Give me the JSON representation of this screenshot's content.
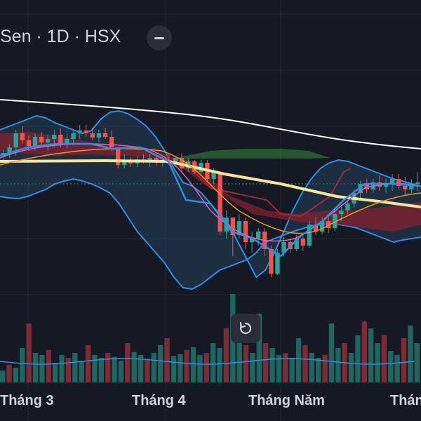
{
  "header": {
    "title": "Sen · 1D · HSX"
  },
  "chart_data": {
    "type": "candlestick",
    "title": "Sen · 1D · HSX",
    "x_tick_labels": [
      "Tháng 3",
      "Tháng 4",
      "Tháng Năm",
      "Thán"
    ],
    "candles": [
      {
        "o": 222,
        "h": 213,
        "l": 230,
        "c": 218
      },
      {
        "o": 218,
        "h": 205,
        "l": 225,
        "c": 210
      },
      {
        "o": 210,
        "h": 185,
        "l": 222,
        "c": 190
      },
      {
        "o": 190,
        "h": 180,
        "l": 205,
        "c": 200
      },
      {
        "o": 200,
        "h": 193,
        "l": 215,
        "c": 208
      },
      {
        "o": 208,
        "h": 190,
        "l": 215,
        "c": 195
      },
      {
        "o": 195,
        "h": 188,
        "l": 208,
        "c": 203
      },
      {
        "o": 203,
        "h": 192,
        "l": 215,
        "c": 198
      },
      {
        "o": 198,
        "h": 185,
        "l": 210,
        "c": 192
      },
      {
        "o": 192,
        "h": 183,
        "l": 210,
        "c": 205
      },
      {
        "o": 205,
        "h": 190,
        "l": 212,
        "c": 198
      },
      {
        "o": 198,
        "h": 187,
        "l": 205,
        "c": 190
      },
      {
        "o": 190,
        "h": 178,
        "l": 198,
        "c": 186
      },
      {
        "o": 186,
        "h": 178,
        "l": 195,
        "c": 190
      },
      {
        "o": 190,
        "h": 182,
        "l": 200,
        "c": 196
      },
      {
        "o": 196,
        "h": 185,
        "l": 203,
        "c": 190
      },
      {
        "o": 190,
        "h": 182,
        "l": 198,
        "c": 195
      },
      {
        "o": 195,
        "h": 186,
        "l": 215,
        "c": 210
      },
      {
        "o": 210,
        "h": 215,
        "l": 240,
        "c": 235
      },
      {
        "o": 235,
        "h": 220,
        "l": 240,
        "c": 228
      },
      {
        "o": 228,
        "h": 224,
        "l": 238,
        "c": 233
      },
      {
        "o": 233,
        "h": 222,
        "l": 238,
        "c": 227
      },
      {
        "o": 227,
        "h": 220,
        "l": 233,
        "c": 231
      },
      {
        "o": 231,
        "h": 220,
        "l": 238,
        "c": 225
      },
      {
        "o": 225,
        "h": 220,
        "l": 236,
        "c": 232
      },
      {
        "o": 232,
        "h": 222,
        "l": 238,
        "c": 228
      },
      {
        "o": 228,
        "h": 220,
        "l": 236,
        "c": 233
      },
      {
        "o": 233,
        "h": 222,
        "l": 238,
        "c": 225
      },
      {
        "o": 225,
        "h": 218,
        "l": 245,
        "c": 240
      },
      {
        "o": 240,
        "h": 225,
        "l": 245,
        "c": 230
      },
      {
        "o": 230,
        "h": 228,
        "l": 248,
        "c": 245
      },
      {
        "o": 245,
        "h": 228,
        "l": 248,
        "c": 232
      },
      {
        "o": 232,
        "h": 228,
        "l": 260,
        "c": 255
      },
      {
        "o": 255,
        "h": 240,
        "l": 262,
        "c": 245
      },
      {
        "o": 245,
        "h": 260,
        "l": 335,
        "c": 330
      },
      {
        "o": 330,
        "h": 300,
        "l": 340,
        "c": 310
      },
      {
        "o": 310,
        "h": 320,
        "l": 365,
        "c": 335
      },
      {
        "o": 335,
        "h": 305,
        "l": 340,
        "c": 315
      },
      {
        "o": 315,
        "h": 310,
        "l": 355,
        "c": 345
      },
      {
        "o": 345,
        "h": 330,
        "l": 360,
        "c": 340
      },
      {
        "o": 340,
        "h": 325,
        "l": 350,
        "c": 330
      },
      {
        "o": 330,
        "h": 325,
        "l": 365,
        "c": 355
      },
      {
        "o": 355,
        "h": 350,
        "l": 395,
        "c": 390
      },
      {
        "o": 390,
        "h": 355,
        "l": 392,
        "c": 360
      },
      {
        "o": 360,
        "h": 338,
        "l": 365,
        "c": 345
      },
      {
        "o": 345,
        "h": 340,
        "l": 360,
        "c": 355
      },
      {
        "o": 355,
        "h": 335,
        "l": 358,
        "c": 340
      },
      {
        "o": 340,
        "h": 335,
        "l": 358,
        "c": 350
      },
      {
        "o": 350,
        "h": 315,
        "l": 353,
        "c": 320
      },
      {
        "o": 320,
        "h": 310,
        "l": 335,
        "c": 330
      },
      {
        "o": 330,
        "h": 310,
        "l": 334,
        "c": 315
      },
      {
        "o": 315,
        "h": 305,
        "l": 332,
        "c": 325
      },
      {
        "o": 325,
        "h": 300,
        "l": 330,
        "c": 305
      },
      {
        "o": 305,
        "h": 295,
        "l": 315,
        "c": 300
      },
      {
        "o": 300,
        "h": 285,
        "l": 305,
        "c": 290
      },
      {
        "o": 290,
        "h": 270,
        "l": 296,
        "c": 275
      },
      {
        "o": 275,
        "h": 258,
        "l": 282,
        "c": 262
      },
      {
        "o": 262,
        "h": 255,
        "l": 275,
        "c": 270
      },
      {
        "o": 270,
        "h": 255,
        "l": 275,
        "c": 260
      },
      {
        "o": 260,
        "h": 250,
        "l": 272,
        "c": 266
      },
      {
        "o": 266,
        "h": 255,
        "l": 275,
        "c": 262
      },
      {
        "o": 262,
        "h": 248,
        "l": 272,
        "c": 255
      },
      {
        "o": 255,
        "h": 248,
        "l": 270,
        "c": 265
      },
      {
        "o": 265,
        "h": 252,
        "l": 278,
        "c": 270
      },
      {
        "o": 270,
        "h": 255,
        "l": 275,
        "c": 262
      },
      {
        "o": 262,
        "h": 245,
        "l": 272,
        "c": 260
      }
    ],
    "volume": [
      12,
      18,
      15,
      35,
      60,
      30,
      28,
      33,
      20,
      28,
      25,
      30,
      22,
      38,
      28,
      25,
      30,
      26,
      22,
      40,
      31,
      28,
      24,
      30,
      38,
      45,
      27,
      29,
      33,
      36,
      28,
      30,
      40,
      35,
      55,
      90,
      45,
      38,
      30,
      70,
      40,
      35,
      28,
      30,
      25,
      45,
      38,
      30,
      25,
      28,
      60,
      35,
      40,
      30,
      48,
      62,
      55,
      40,
      48,
      32,
      28,
      45,
      58,
      40
    ],
    "colors": {
      "background": "#151924",
      "up": "#26a69a",
      "down": "#ef5350",
      "bollinger": "#2f8fe6",
      "white_ma": "#ffffff",
      "yellow_ma": "#f5e795",
      "orange_ma": "#f7931a",
      "pink_ma": "#e35bb5",
      "volume_ma": "#2f8fe6"
    },
    "grid": true
  }
}
